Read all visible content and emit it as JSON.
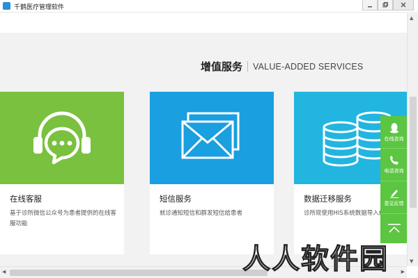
{
  "window": {
    "title": "千鹊医疗管理软件",
    "controls": [
      "minimize",
      "maximize",
      "close"
    ]
  },
  "section": {
    "title_cn": "增值服务",
    "title_en": "VALUE-ADDED SERVICES"
  },
  "cards": [
    {
      "title": "在线客服",
      "desc": "基于诊所微信公众号为患者提供的在线客服功能",
      "color": "#7ac13f",
      "icon": "chat-headset-icon"
    },
    {
      "title": "短信服务",
      "desc": "就诊通知短信和群发短信给患者",
      "color": "#1a9fe0",
      "icon": "envelope-icon"
    },
    {
      "title": "数据迁移服务",
      "desc": "诊所现使用HIS系统数据导入疗系统",
      "color": "#22b5e0",
      "icon": "database-icon"
    }
  ],
  "float_bar": {
    "items": [
      {
        "label": "在线咨询",
        "icon": "qq-penguin-icon"
      },
      {
        "label": "电话咨询",
        "icon": "phone-icon"
      },
      {
        "label": "意见反馈",
        "icon": "pen-icon"
      }
    ],
    "top_icon": "back-to-top-icon",
    "color": "#5cc542"
  },
  "watermark": "人人软件园"
}
